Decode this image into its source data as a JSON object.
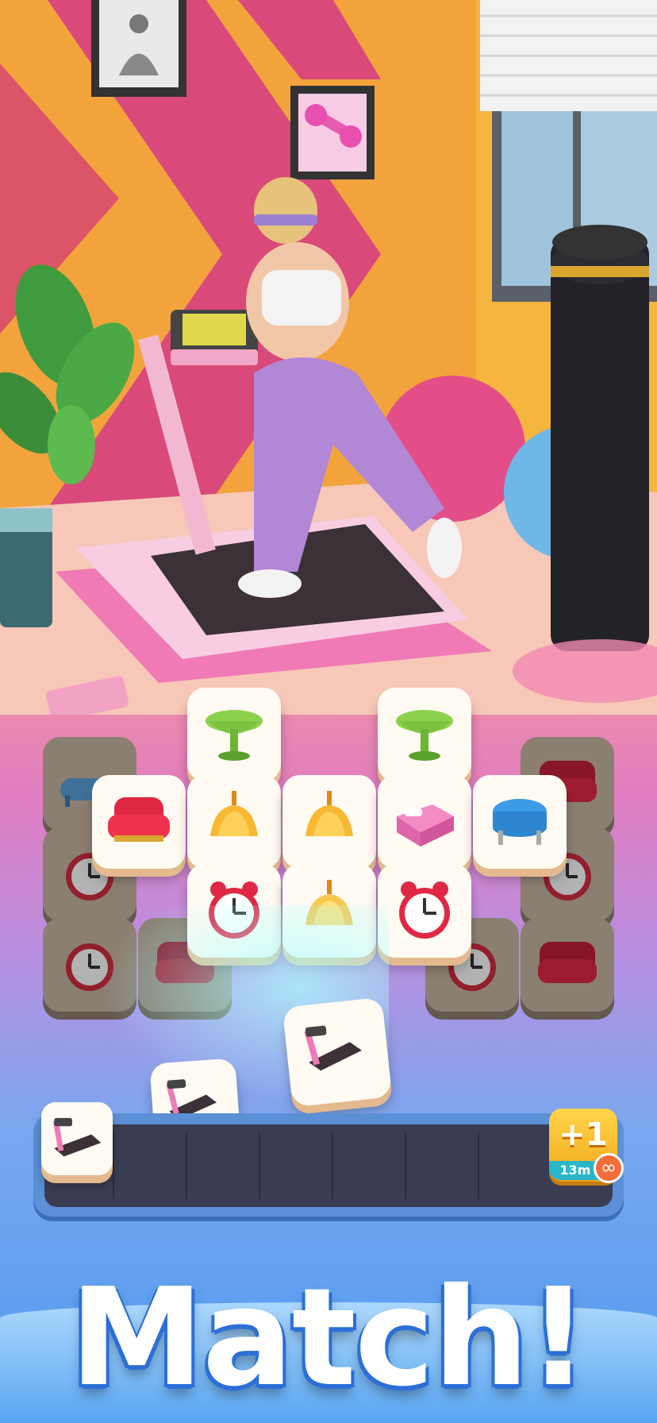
{
  "scene": {
    "description_icons": [
      "treadmill",
      "punching-bag",
      "yoga-ball",
      "plant",
      "dumbbell-picture",
      "meditation-picture",
      "window-blinds",
      "scale"
    ]
  },
  "board": {
    "tiles_front": [
      {
        "icon": "table-icon"
      },
      {
        "icon": "table-icon"
      },
      {
        "icon": "armchair-icon"
      },
      {
        "icon": "lamp-icon"
      },
      {
        "icon": "lamp-icon"
      },
      {
        "icon": "bed-icon"
      },
      {
        "icon": "stool-icon"
      },
      {
        "icon": "alarm-clock-icon"
      },
      {
        "icon": "lamp-icon"
      },
      {
        "icon": "alarm-clock-icon"
      }
    ],
    "tiles_back": [
      {
        "icon": "bathtub-icon"
      },
      {
        "icon": "armchair-icon"
      },
      {
        "icon": "alarm-clock-icon"
      },
      {
        "icon": "alarm-clock-icon"
      },
      {
        "icon": "alarm-clock-icon"
      },
      {
        "icon": "armchair-icon"
      },
      {
        "icon": "alarm-clock-icon"
      },
      {
        "icon": "armchair-icon"
      }
    ],
    "flying_tiles": [
      {
        "icon": "treadmill-icon"
      },
      {
        "icon": "treadmill-icon"
      }
    ]
  },
  "tray": {
    "slots": 7,
    "filled": [
      {
        "icon": "treadmill-icon"
      }
    ],
    "booster": {
      "label": "+1",
      "timer": "13m",
      "infinity_icon": "infinity-icon"
    }
  },
  "headline": "Match!",
  "colors": {
    "wall": "#f3a33c",
    "tile_face": "#fffaf2",
    "tray": "#3a3d52",
    "booster": "#f5b51e",
    "timer_bg": "#2bb6c8",
    "headline_stroke": "#2c6fd6"
  }
}
